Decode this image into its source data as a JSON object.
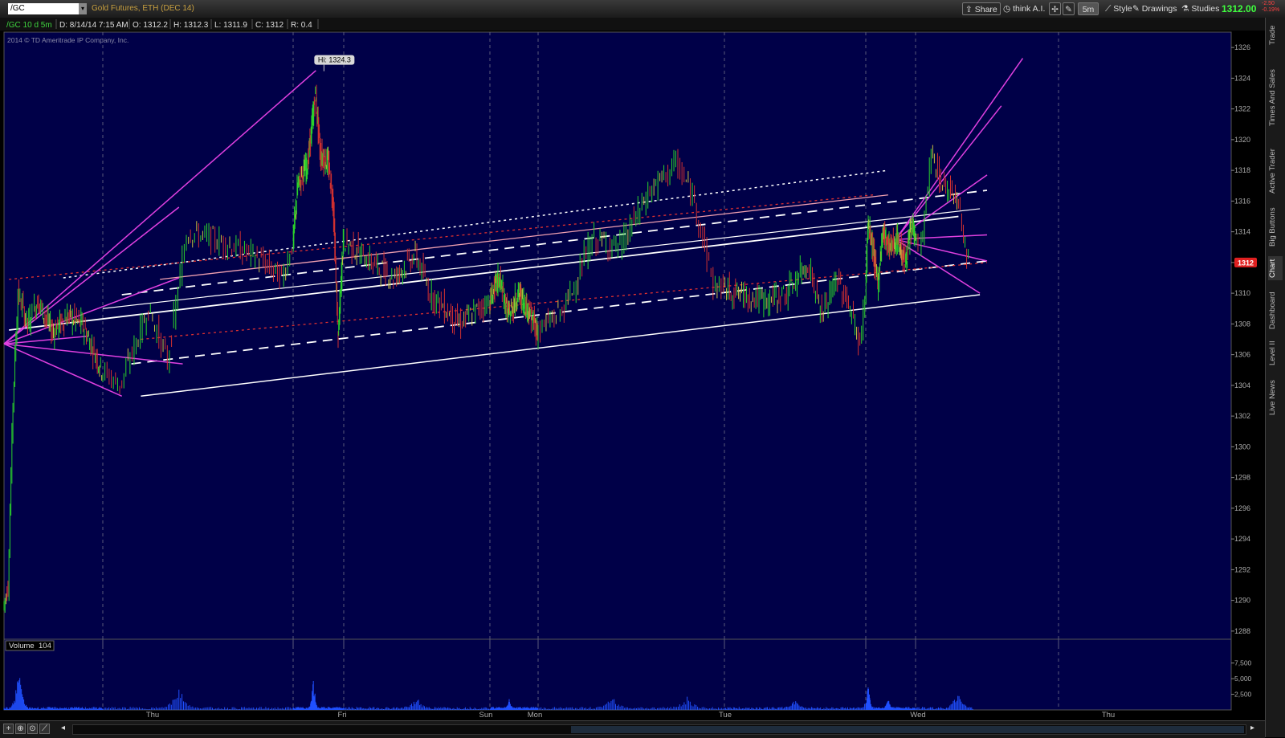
{
  "header": {
    "symbol": "/GC",
    "description": "Gold Futures, ETH (DEC 14)",
    "buttons": {
      "share": "Share",
      "think": "think A.I.",
      "timeframe": "5m",
      "style": "Style",
      "drawings": "Drawings",
      "studies": "Studies"
    },
    "last_price": "1312.00",
    "change": "-2.50",
    "change_pct": "-0.19%"
  },
  "sidebar": {
    "tabs": [
      "Trade",
      "Times And Sales",
      "Active Trader",
      "Big Buttons",
      "Chart",
      "Dashboard",
      "Level II",
      "Live News"
    ]
  },
  "chart_info": {
    "fields": [
      "/GC 10 d 5m",
      "D: 8/14/14 7:15 AM",
      "O: 1312.2",
      "H: 1312.3",
      "L: 1311.9",
      "C: 1312",
      "R: 0.4"
    ],
    "copyright": "2014 © TD Ameritrade IP Company, Inc.",
    "hi_label": "Hi: 1324.3",
    "price_tag": "1312"
  },
  "colors": {
    "background": "#000048",
    "up": "#2bd42b",
    "down": "#d03030",
    "neutral": "#c8c040",
    "channel": "#ffffff",
    "fork": "#e040e0",
    "red_dotted": "#e03030",
    "pink": "#f0a0b0",
    "volume": "#2050ff",
    "price_tag": "#e02020"
  },
  "chart_data": [
    {
      "type": "candlestick",
      "title": "",
      "x_ticks": [
        "Thu",
        "Fri",
        "Sun",
        "Mon",
        "Tue",
        "Wed",
        "Thu"
      ],
      "y_ticks": [
        1326,
        1324,
        1322,
        1320,
        1318,
        1316,
        1314,
        1312,
        1310,
        1308,
        1306,
        1304,
        1302,
        1300,
        1298,
        1296,
        1294,
        1292,
        1290,
        1288
      ],
      "ylim": [
        1287,
        1327
      ],
      "grid": true,
      "price_path": [
        {
          "day_pos": 0.0,
          "price": 1289.5
        },
        {
          "day_pos": 0.05,
          "price": 1291
        },
        {
          "day_pos": 0.1,
          "price": 1303
        },
        {
          "day_pos": 0.15,
          "price": 1310
        },
        {
          "day_pos": 0.25,
          "price": 1308
        },
        {
          "day_pos": 0.35,
          "price": 1309.5
        },
        {
          "day_pos": 0.5,
          "price": 1307.5
        },
        {
          "day_pos": 0.65,
          "price": 1308.5
        },
        {
          "day_pos": 0.8,
          "price": 1308
        },
        {
          "day_pos": 1.0,
          "price": 1305
        },
        {
          "day_pos": 1.1,
          "price": 1304
        },
        {
          "day_pos": 1.25,
          "price": 1309
        },
        {
          "day_pos": 1.35,
          "price": 1305.5
        },
        {
          "day_pos": 1.45,
          "price": 1314
        },
        {
          "day_pos": 1.6,
          "price": 1313.5
        },
        {
          "day_pos": 1.8,
          "price": 1312.5
        },
        {
          "day_pos": 1.95,
          "price": 1311
        },
        {
          "day_pos": 2.1,
          "price": 1317
        },
        {
          "day_pos": 2.3,
          "price": 1318.5
        },
        {
          "day_pos": 2.45,
          "price": 1323
        },
        {
          "day_pos": 2.55,
          "price": 1319
        },
        {
          "day_pos": 2.7,
          "price": 1318.5
        },
        {
          "day_pos": 2.8,
          "price": 1316
        },
        {
          "day_pos": 2.9,
          "price": 1307
        },
        {
          "day_pos": 3.0,
          "price": 1313.5
        },
        {
          "day_pos": 3.2,
          "price": 1312
        },
        {
          "day_pos": 3.35,
          "price": 1311
        },
        {
          "day_pos": 3.5,
          "price": 1312.5
        },
        {
          "day_pos": 3.6,
          "price": 1310
        },
        {
          "day_pos": 3.8,
          "price": 1308
        },
        {
          "day_pos": 4.0,
          "price": 1309.5
        },
        {
          "day_pos": 4.2,
          "price": 1311
        },
        {
          "day_pos": 4.4,
          "price": 1308.5
        },
        {
          "day_pos": 4.6,
          "price": 1310
        },
        {
          "day_pos": 4.8,
          "price": 1309
        },
        {
          "day_pos": 5.0,
          "price": 1307.5
        },
        {
          "day_pos": 5.15,
          "price": 1309
        },
        {
          "day_pos": 5.3,
          "price": 1313.5
        },
        {
          "day_pos": 5.45,
          "price": 1313
        },
        {
          "day_pos": 5.6,
          "price": 1316.5
        },
        {
          "day_pos": 5.75,
          "price": 1318.5
        },
        {
          "day_pos": 5.85,
          "price": 1316
        },
        {
          "day_pos": 5.95,
          "price": 1310.5
        },
        {
          "day_pos": 6.1,
          "price": 1310
        },
        {
          "day_pos": 6.3,
          "price": 1309.5
        },
        {
          "day_pos": 6.45,
          "price": 1310
        },
        {
          "day_pos": 6.6,
          "price": 1312
        },
        {
          "day_pos": 6.7,
          "price": 1308.5
        },
        {
          "day_pos": 6.8,
          "price": 1311
        },
        {
          "day_pos": 6.9,
          "price": 1309
        },
        {
          "day_pos": 6.97,
          "price": 1306.5
        },
        {
          "day_pos": 7.05,
          "price": 1314.5
        },
        {
          "day_pos": 7.15,
          "price": 1313
        },
        {
          "day_pos": 7.25,
          "price": 1310.5
        },
        {
          "day_pos": 7.35,
          "price": 1314
        },
        {
          "day_pos": 7.5,
          "price": 1313
        },
        {
          "day_pos": 7.65,
          "price": 1313.5
        },
        {
          "day_pos": 7.8,
          "price": 1312
        },
        {
          "day_pos": 7.95,
          "price": 1314.5
        },
        {
          "day_pos": 8.05,
          "price": 1313
        },
        {
          "day_pos": 8.12,
          "price": 1319
        },
        {
          "day_pos": 8.2,
          "price": 1317
        },
        {
          "day_pos": 8.3,
          "price": 1316.5
        },
        {
          "day_pos": 8.38,
          "price": 1312
        }
      ],
      "annotations": {
        "high": {
          "day_pos": 2.45,
          "price": 1324.3,
          "label": "Hi: 1324.3"
        },
        "last": {
          "price": 1312
        }
      }
    },
    {
      "type": "bar",
      "title": "Volume",
      "value_label": "104",
      "y_ticks": [
        "7,500",
        "5,000",
        "2,500"
      ],
      "ylim": [
        0,
        9000
      ],
      "note_series": "volume spikes",
      "spikes": [
        {
          "day_pos": 0.15,
          "value": 7600
        },
        {
          "day_pos": 1.4,
          "value": 4200
        },
        {
          "day_pos": 2.4,
          "value": 5600
        },
        {
          "day_pos": 3.5,
          "value": 1800
        },
        {
          "day_pos": 4.4,
          "value": 1400
        },
        {
          "day_pos": 5.4,
          "value": 2200
        },
        {
          "day_pos": 5.8,
          "value": 1800
        },
        {
          "day_pos": 6.5,
          "value": 1600
        },
        {
          "day_pos": 7.05,
          "value": 4800
        },
        {
          "day_pos": 7.45,
          "value": 1800
        },
        {
          "day_pos": 8.3,
          "value": 3000
        }
      ]
    }
  ]
}
